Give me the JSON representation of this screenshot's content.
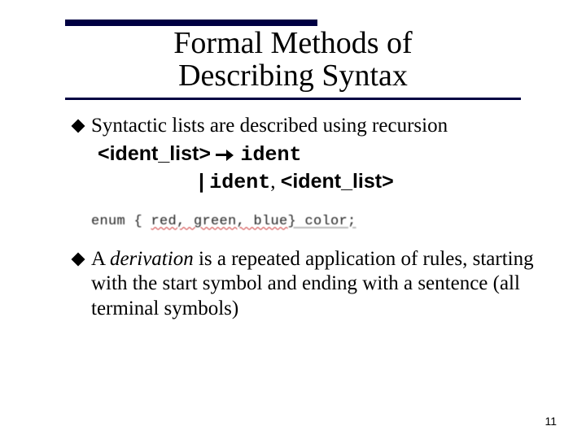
{
  "title_line1": "Formal Methods of",
  "title_line2": "Describing Syntax",
  "bullet1": "Syntactic lists are described using recursion",
  "grammar": {
    "lhs": "<ident_list>",
    "rhs1": "ident",
    "pipe": "|",
    "rhs2_a": "ident",
    "rhs2_comma": ", ",
    "rhs2_b": "<ident_list>"
  },
  "enum_example": {
    "prefix": "enum { ",
    "ids": "red, green, blue",
    "suffix": "} color;"
  },
  "bullet2_a": "A ",
  "bullet2_em": "derivation",
  "bullet2_b": " is a repeated application of rules, starting with the start symbol and ending with a sentence (all terminal symbols)",
  "page_number": "11"
}
